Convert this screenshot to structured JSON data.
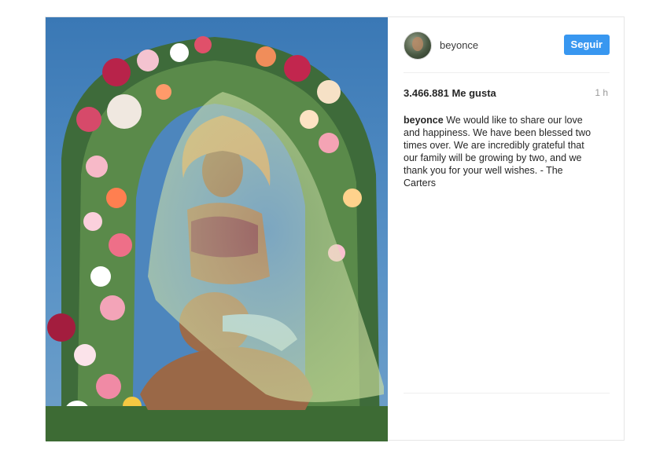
{
  "post": {
    "username": "beyonce",
    "follow_label": "Seguir",
    "likes": "3.466.881 Me gusta",
    "time": "1 h",
    "caption_user": "beyonce",
    "caption_text": "We would like to share our love and happiness. We have been blessed two times over. We are incredibly grateful that our family will be growing by two, and we thank you for your well wishes. - The Carters"
  },
  "colors": {
    "follow_button": "#3897f0",
    "text": "#262626",
    "timestamp": "#999999"
  },
  "icons": [
    "avatar-photo"
  ]
}
